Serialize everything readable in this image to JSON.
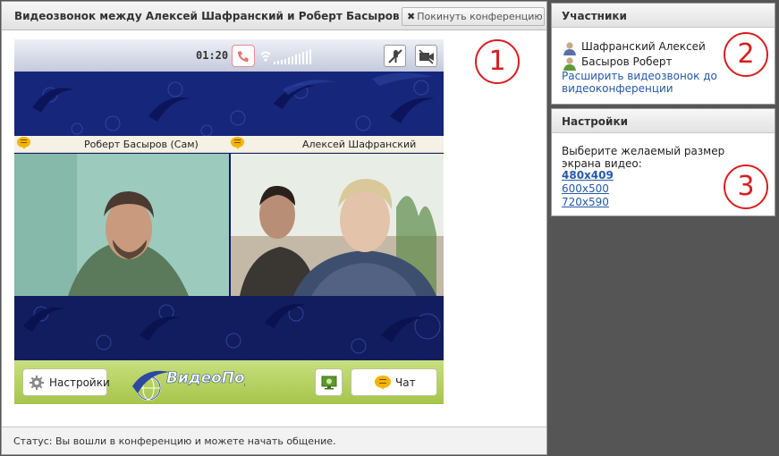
{
  "conference": {
    "title": "Видеозвонок между Алексей Шафранский и Роберт Басыров",
    "leave_label": "Покинуть конференцию",
    "status": "Статус: Вы вошли в конференцию и можете начать общение."
  },
  "video": {
    "timer": "01:20",
    "left_name": "Роберт Басыров (Сам)",
    "right_name": "Алексей Шафранский",
    "settings_label": "Настройки",
    "chat_label": "Чат",
    "logo_text": "ВидеоПорт"
  },
  "participants": {
    "header": "Участники",
    "items": [
      {
        "name": "Шафранский Алексей",
        "icon": "person-icon"
      },
      {
        "name": "Басыров Роберт",
        "icon": "person-icon"
      }
    ],
    "expand_link": "Расширить видеозвонок до видеоконференции"
  },
  "settings": {
    "header": "Настройки",
    "description": "Выберите желаемый размер экрана видео:",
    "sizes": [
      "480x409",
      "600x500",
      "720x590"
    ],
    "selected_size": "480x409"
  },
  "callouts": [
    "1",
    "2",
    "3"
  ],
  "colors": {
    "background": "#555555",
    "band_blue": "#16267a",
    "toolbar_green": "#a6c54a",
    "link_blue": "#2458a8",
    "callout_red": "#d81d1d"
  }
}
